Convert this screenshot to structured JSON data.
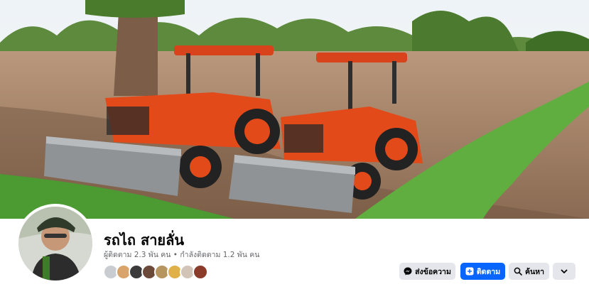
{
  "profile": {
    "name": "รถไถ สายลั่น",
    "followers_text": "ผู้ติดตาม 2.3 พัน คน",
    "separator": " • ",
    "following_text": "กำลังติดตาม 1.2 พัน คน"
  },
  "actions": {
    "message_label": "ส่งข้อความ",
    "follow_label": "ติดตาม",
    "search_label": "ค้นหา"
  },
  "colors": {
    "accent": "#0866ff",
    "button_gray": "#e4e6eb",
    "tractor_orange": "#e24a1a"
  },
  "icons": {
    "message": "messenger-icon",
    "follow": "follow-icon",
    "search": "search-icon",
    "more": "chevron-down-icon"
  },
  "follower_avatars": [
    "follower-1",
    "follower-2",
    "follower-3",
    "follower-4",
    "follower-5",
    "follower-6",
    "follower-7"
  ]
}
